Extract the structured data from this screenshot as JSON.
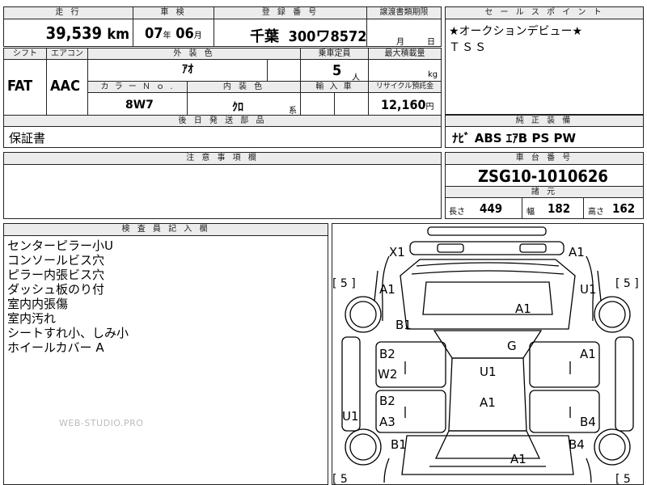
{
  "headers": {
    "mileage": "走 行",
    "inspection": "車 検",
    "registration": "登 録 番 号",
    "transfer_deadline": "譲渡書類期限",
    "sales_point": "セ ー ル ス ポ イ ン ト",
    "shift": "シフト",
    "aircon": "エアコン",
    "exterior_color": "外 装 色",
    "capacity": "乗車定員",
    "max_load": "最大積載量",
    "color_no": "カ ラ ー Ｎ ｏ .",
    "interior_color": "内 装 色",
    "import": "輸 入 車",
    "recycle": "リサイクル預託金",
    "post_parts": "後 日 発 送 部 品",
    "genuine_equipment": "純 正 装 備",
    "notes": "注 意 事 項 欄",
    "chassis_no": "車 台 番 号",
    "specs": "諸 元",
    "inspector": "検 査 員 記 入 欄"
  },
  "vehicle": {
    "mileage_value": "39,539",
    "mileage_unit": "km",
    "inspection_year": "07",
    "year_unit": "年",
    "inspection_month": "06",
    "month_unit": "月",
    "reg_area": "千葉",
    "reg_number": "300ワ8572",
    "transfer_month_unit": "月",
    "transfer_day_unit": "日",
    "shift": "FAT",
    "aircon": "AAC",
    "exterior_color": "ｱｵ",
    "capacity": "5",
    "capacity_unit": "人",
    "load_unit": "kg",
    "color_no": "8W7",
    "interior_color": "ｸﾛ",
    "interior_suffix": "系",
    "recycle_fee": "12,160",
    "recycle_unit": "円",
    "post_parts": "保証書",
    "chassis_no": "ZSG10-1010626",
    "length_label": "長さ",
    "length": "449",
    "width_label": "幅",
    "width": "182",
    "height_label": "高さ",
    "height": "162"
  },
  "sales_points": [
    "★オークションデビュー★",
    "ＴＳＳ"
  ],
  "equipment": "ﾅﾋﾞ ABS ｴｱB PS PW",
  "inspector_notes": [
    "センターピラー小U",
    "コンソールビス穴",
    "ピラー内張ビス穴",
    "ダッシュ板のり付",
    "室内内張傷",
    "室内汚れ",
    "シートすれ小、しみ小",
    "ホイールカバー A"
  ],
  "watermark": "WEB-STUDIO.PRO",
  "diagram_marks": {
    "x1": "X1",
    "a1_top_right": "A1",
    "tire_left_front": "[ 5 ]",
    "tire_right_front": "[ 5 ]",
    "a1_left_fender": "A1",
    "u1_right_fender": "U1",
    "a1_hood": "A1",
    "b1_left_front": "B1",
    "g_windshield": "G",
    "b2_left_door": "B2",
    "w2_left_door": "W2",
    "a1_right_door": "A1",
    "u1_roof": "U1",
    "b2_left_rear_door": "B2",
    "a1_roof_rear": "A1",
    "a3_left_rear_door": "A3",
    "u1_left_sill": "U1",
    "b4_right_rear_door": "B4",
    "b1_left_rear": "B1",
    "b4_right_rear": "B4",
    "a1_trunk": "A1",
    "tire_left_rear": "[ 5",
    "tire_right_rear": "[ 5"
  }
}
